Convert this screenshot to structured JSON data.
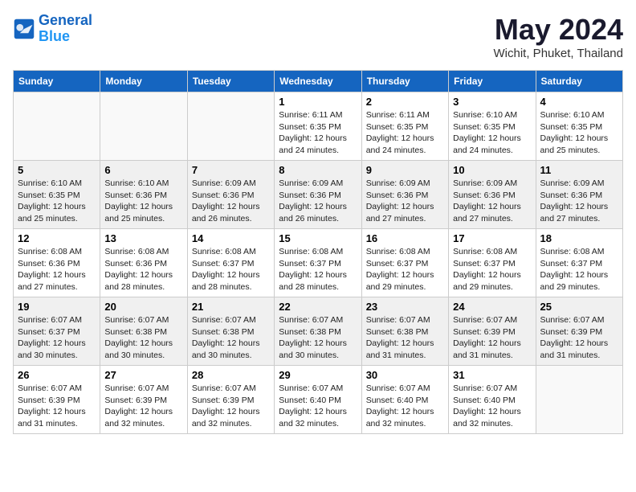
{
  "header": {
    "logo_line1": "General",
    "logo_line2": "Blue",
    "month": "May 2024",
    "location": "Wichit, Phuket, Thailand"
  },
  "weekdays": [
    "Sunday",
    "Monday",
    "Tuesday",
    "Wednesday",
    "Thursday",
    "Friday",
    "Saturday"
  ],
  "weeks": [
    [
      {
        "day": "",
        "sunrise": "",
        "sunset": "",
        "daylight": ""
      },
      {
        "day": "",
        "sunrise": "",
        "sunset": "",
        "daylight": ""
      },
      {
        "day": "",
        "sunrise": "",
        "sunset": "",
        "daylight": ""
      },
      {
        "day": "1",
        "sunrise": "Sunrise: 6:11 AM",
        "sunset": "Sunset: 6:35 PM",
        "daylight": "Daylight: 12 hours and 24 minutes."
      },
      {
        "day": "2",
        "sunrise": "Sunrise: 6:11 AM",
        "sunset": "Sunset: 6:35 PM",
        "daylight": "Daylight: 12 hours and 24 minutes."
      },
      {
        "day": "3",
        "sunrise": "Sunrise: 6:10 AM",
        "sunset": "Sunset: 6:35 PM",
        "daylight": "Daylight: 12 hours and 24 minutes."
      },
      {
        "day": "4",
        "sunrise": "Sunrise: 6:10 AM",
        "sunset": "Sunset: 6:35 PM",
        "daylight": "Daylight: 12 hours and 25 minutes."
      }
    ],
    [
      {
        "day": "5",
        "sunrise": "Sunrise: 6:10 AM",
        "sunset": "Sunset: 6:35 PM",
        "daylight": "Daylight: 12 hours and 25 minutes."
      },
      {
        "day": "6",
        "sunrise": "Sunrise: 6:10 AM",
        "sunset": "Sunset: 6:36 PM",
        "daylight": "Daylight: 12 hours and 25 minutes."
      },
      {
        "day": "7",
        "sunrise": "Sunrise: 6:09 AM",
        "sunset": "Sunset: 6:36 PM",
        "daylight": "Daylight: 12 hours and 26 minutes."
      },
      {
        "day": "8",
        "sunrise": "Sunrise: 6:09 AM",
        "sunset": "Sunset: 6:36 PM",
        "daylight": "Daylight: 12 hours and 26 minutes."
      },
      {
        "day": "9",
        "sunrise": "Sunrise: 6:09 AM",
        "sunset": "Sunset: 6:36 PM",
        "daylight": "Daylight: 12 hours and 27 minutes."
      },
      {
        "day": "10",
        "sunrise": "Sunrise: 6:09 AM",
        "sunset": "Sunset: 6:36 PM",
        "daylight": "Daylight: 12 hours and 27 minutes."
      },
      {
        "day": "11",
        "sunrise": "Sunrise: 6:09 AM",
        "sunset": "Sunset: 6:36 PM",
        "daylight": "Daylight: 12 hours and 27 minutes."
      }
    ],
    [
      {
        "day": "12",
        "sunrise": "Sunrise: 6:08 AM",
        "sunset": "Sunset: 6:36 PM",
        "daylight": "Daylight: 12 hours and 27 minutes."
      },
      {
        "day": "13",
        "sunrise": "Sunrise: 6:08 AM",
        "sunset": "Sunset: 6:36 PM",
        "daylight": "Daylight: 12 hours and 28 minutes."
      },
      {
        "day": "14",
        "sunrise": "Sunrise: 6:08 AM",
        "sunset": "Sunset: 6:37 PM",
        "daylight": "Daylight: 12 hours and 28 minutes."
      },
      {
        "day": "15",
        "sunrise": "Sunrise: 6:08 AM",
        "sunset": "Sunset: 6:37 PM",
        "daylight": "Daylight: 12 hours and 28 minutes."
      },
      {
        "day": "16",
        "sunrise": "Sunrise: 6:08 AM",
        "sunset": "Sunset: 6:37 PM",
        "daylight": "Daylight: 12 hours and 29 minutes."
      },
      {
        "day": "17",
        "sunrise": "Sunrise: 6:08 AM",
        "sunset": "Sunset: 6:37 PM",
        "daylight": "Daylight: 12 hours and 29 minutes."
      },
      {
        "day": "18",
        "sunrise": "Sunrise: 6:08 AM",
        "sunset": "Sunset: 6:37 PM",
        "daylight": "Daylight: 12 hours and 29 minutes."
      }
    ],
    [
      {
        "day": "19",
        "sunrise": "Sunrise: 6:07 AM",
        "sunset": "Sunset: 6:37 PM",
        "daylight": "Daylight: 12 hours and 30 minutes."
      },
      {
        "day": "20",
        "sunrise": "Sunrise: 6:07 AM",
        "sunset": "Sunset: 6:38 PM",
        "daylight": "Daylight: 12 hours and 30 minutes."
      },
      {
        "day": "21",
        "sunrise": "Sunrise: 6:07 AM",
        "sunset": "Sunset: 6:38 PM",
        "daylight": "Daylight: 12 hours and 30 minutes."
      },
      {
        "day": "22",
        "sunrise": "Sunrise: 6:07 AM",
        "sunset": "Sunset: 6:38 PM",
        "daylight": "Daylight: 12 hours and 30 minutes."
      },
      {
        "day": "23",
        "sunrise": "Sunrise: 6:07 AM",
        "sunset": "Sunset: 6:38 PM",
        "daylight": "Daylight: 12 hours and 31 minutes."
      },
      {
        "day": "24",
        "sunrise": "Sunrise: 6:07 AM",
        "sunset": "Sunset: 6:39 PM",
        "daylight": "Daylight: 12 hours and 31 minutes."
      },
      {
        "day": "25",
        "sunrise": "Sunrise: 6:07 AM",
        "sunset": "Sunset: 6:39 PM",
        "daylight": "Daylight: 12 hours and 31 minutes."
      }
    ],
    [
      {
        "day": "26",
        "sunrise": "Sunrise: 6:07 AM",
        "sunset": "Sunset: 6:39 PM",
        "daylight": "Daylight: 12 hours and 31 minutes."
      },
      {
        "day": "27",
        "sunrise": "Sunrise: 6:07 AM",
        "sunset": "Sunset: 6:39 PM",
        "daylight": "Daylight: 12 hours and 32 minutes."
      },
      {
        "day": "28",
        "sunrise": "Sunrise: 6:07 AM",
        "sunset": "Sunset: 6:39 PM",
        "daylight": "Daylight: 12 hours and 32 minutes."
      },
      {
        "day": "29",
        "sunrise": "Sunrise: 6:07 AM",
        "sunset": "Sunset: 6:40 PM",
        "daylight": "Daylight: 12 hours and 32 minutes."
      },
      {
        "day": "30",
        "sunrise": "Sunrise: 6:07 AM",
        "sunset": "Sunset: 6:40 PM",
        "daylight": "Daylight: 12 hours and 32 minutes."
      },
      {
        "day": "31",
        "sunrise": "Sunrise: 6:07 AM",
        "sunset": "Sunset: 6:40 PM",
        "daylight": "Daylight: 12 hours and 32 minutes."
      },
      {
        "day": "",
        "sunrise": "",
        "sunset": "",
        "daylight": ""
      }
    ]
  ]
}
